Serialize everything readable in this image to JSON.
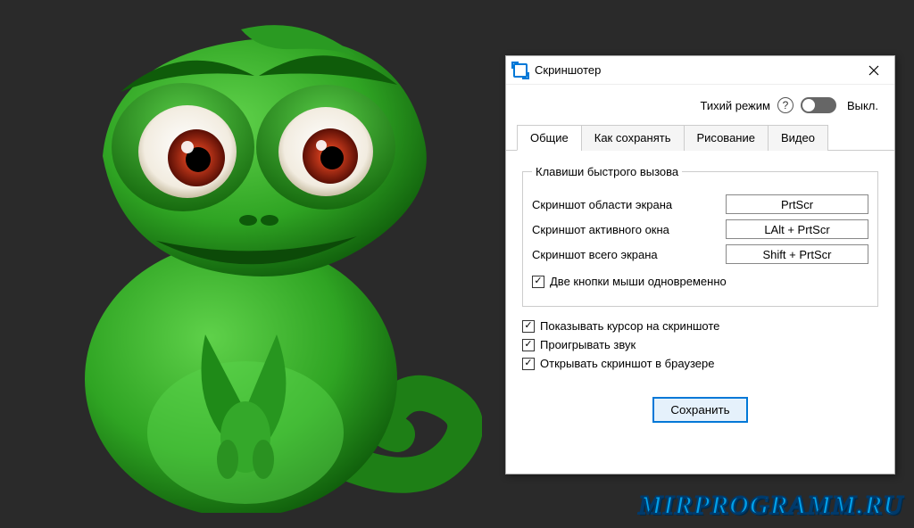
{
  "window": {
    "title": "Скриншотер"
  },
  "mode": {
    "label": "Тихий режим",
    "state_text": "Выкл."
  },
  "tabs": [
    {
      "label": "Общие"
    },
    {
      "label": "Как сохранять"
    },
    {
      "label": "Рисование"
    },
    {
      "label": "Видео"
    }
  ],
  "hotkeys": {
    "legend": "Клавиши быстрого вызова",
    "rows": [
      {
        "label": "Скриншот области экрана",
        "value": "PrtScr"
      },
      {
        "label": "Скриншот активного окна",
        "value": "LAlt + PrtScr"
      },
      {
        "label": "Скриншот всего экрана",
        "value": "Shift + PrtScr"
      }
    ],
    "two_buttons": "Две кнопки мыши одновременно"
  },
  "options": {
    "show_cursor": "Показывать курсор на скриншоте",
    "play_sound": "Проигрывать звук",
    "open_browser": "Открывать скриншот в браузере"
  },
  "save_button": "Сохранить",
  "watermark": "MIRPROGRAMM.RU"
}
